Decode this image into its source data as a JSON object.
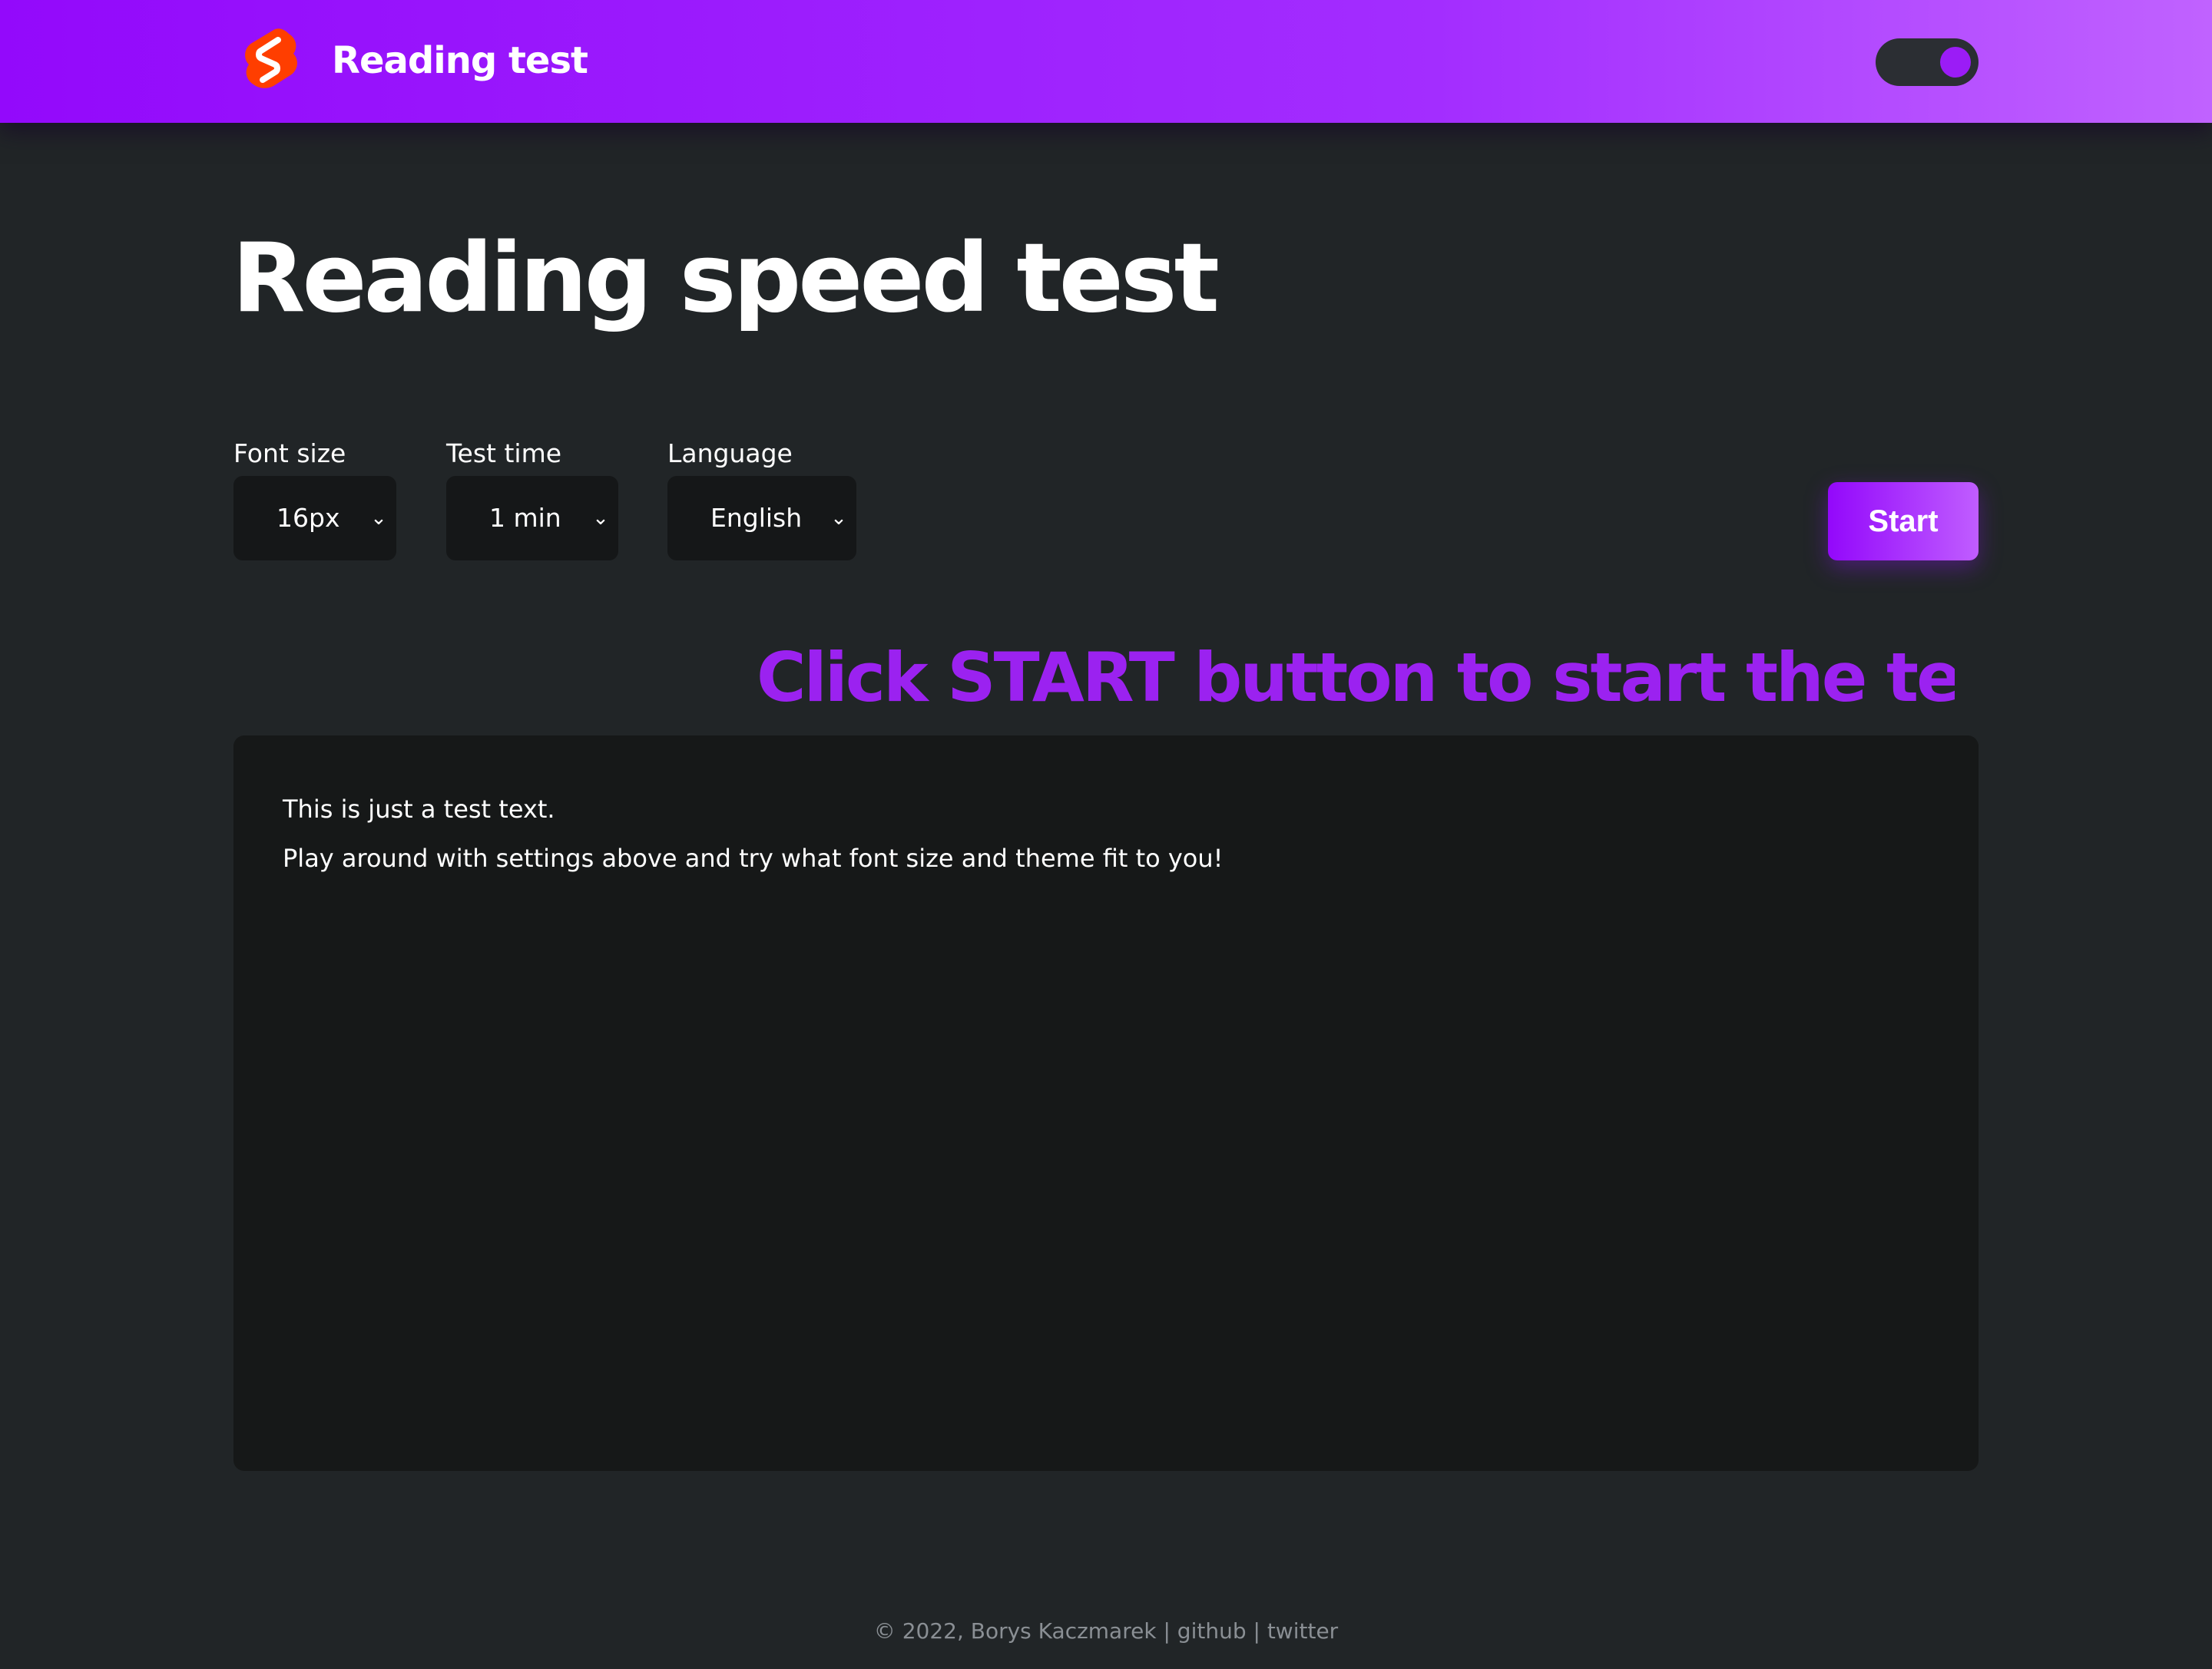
{
  "header": {
    "brand": "Reading test",
    "theme_toggle_state": "dark",
    "colors": {
      "gradient_start": "#9309fb",
      "gradient_end": "#c062ff"
    }
  },
  "main": {
    "title": "Reading speed test",
    "controls": {
      "font_size": {
        "label": "Font size",
        "value": "16px"
      },
      "test_time": {
        "label": "Test time",
        "value": "1 min"
      },
      "language": {
        "label": "Language",
        "value": "English"
      }
    },
    "start_label": "Start",
    "hint": "Click START button to start the test",
    "reading_text": {
      "line1": "This is just a test text.",
      "line2": "Play around with settings above and try what font size and theme fit to you!"
    }
  },
  "footer": {
    "copyright": "© 2022, Borys Kaczmarek",
    "sep1": " | ",
    "github": "github",
    "sep2": " | ",
    "twitter": "twitter"
  },
  "icons": {
    "logo": "svelte-logo-icon",
    "chevron": "chevron-down-icon"
  },
  "accent_color": "#9b22f0"
}
